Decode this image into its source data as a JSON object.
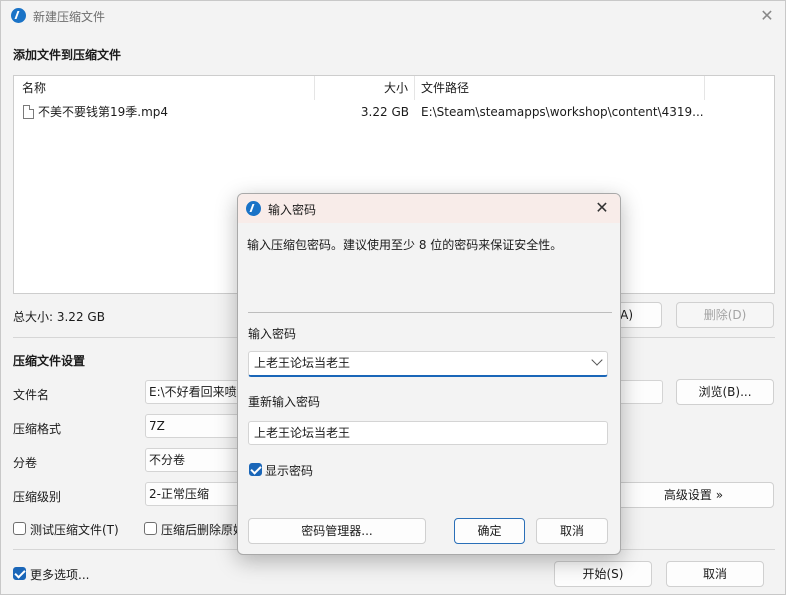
{
  "main": {
    "title": "新建压缩文件",
    "add_section_title": "添加文件到压缩文件",
    "table": {
      "headers": {
        "name": "名称",
        "size": "大小",
        "path": "文件路径"
      },
      "rows": [
        {
          "name": "不美不要钱第19季.mp4",
          "size": "3.22 GB",
          "path": "E:\\Steam\\steamapps\\workshop\\content\\4319..."
        }
      ]
    },
    "total_size": "总大小: 3.22 GB",
    "add_button_partial": "A)",
    "delete_button": "删除(D)",
    "settings_title": "压缩文件设置",
    "labels": {
      "filename": "文件名",
      "format": "压缩格式",
      "volume": "分卷",
      "level": "压缩级别"
    },
    "values": {
      "filename": "E:\\不好看回来喷",
      "format": "7Z",
      "volume": "不分卷",
      "level": "2-正常压缩"
    },
    "browse_button": "浏览(B)...",
    "advanced_button": "高级设置 »",
    "test_checkbox": "测试压缩文件(T)",
    "delete_after_checkbox": "压缩后删除原始",
    "more_options": "更多选项...",
    "start_button": "开始(S)",
    "cancel_button": "取消"
  },
  "dialog": {
    "title": "输入密码",
    "description": "输入压缩包密码。建议使用至少 8 位的密码来保证安全性。",
    "password_label": "输入密码",
    "password_value": "上老王论坛当老王",
    "reenter_label": "重新输入密码",
    "reenter_value": "上老王论坛当老王",
    "show_password": "显示密码",
    "manager_button": "密码管理器...",
    "ok_button": "确定",
    "cancel_button": "取消"
  },
  "colors": {
    "accent": "#1a66b8",
    "dialog_titlebar": "#f8ece9"
  }
}
